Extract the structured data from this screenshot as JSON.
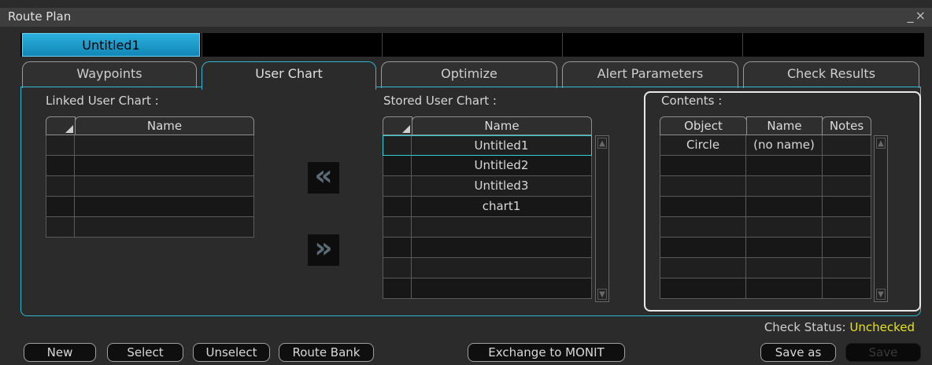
{
  "window": {
    "title": "Route Plan",
    "controls": "_×"
  },
  "route_fields": {
    "active": "Untitled1"
  },
  "tabs": [
    {
      "label": "Waypoints",
      "active": false
    },
    {
      "label": "User Chart",
      "active": true
    },
    {
      "label": "Optimize",
      "active": false
    },
    {
      "label": "Alert Parameters",
      "active": false
    },
    {
      "label": "Check Results",
      "active": false
    }
  ],
  "linked": {
    "label": "Linked User Chart :",
    "header": "Name",
    "rows": [
      "",
      "",
      "",
      "",
      ""
    ]
  },
  "transfer": {
    "add": "«",
    "remove": "»"
  },
  "stored": {
    "label": "Stored User Chart :",
    "header": "Name",
    "rows": [
      "Untitled1",
      "Untitled2",
      "Untitled3",
      "chart1",
      "",
      "",
      "",
      ""
    ],
    "selected_index": 0
  },
  "contents": {
    "label": "Contents :",
    "headers": [
      "Object",
      "Name",
      "Notes"
    ],
    "rows": [
      [
        "Circle",
        "(no name)",
        ""
      ],
      [
        "",
        "",
        ""
      ],
      [
        "",
        "",
        ""
      ],
      [
        "",
        "",
        ""
      ],
      [
        "",
        "",
        ""
      ],
      [
        "",
        "",
        ""
      ],
      [
        "",
        "",
        ""
      ],
      [
        "",
        "",
        ""
      ]
    ]
  },
  "check_status": {
    "label": "Check Status:",
    "value": "Unchecked"
  },
  "buttons": {
    "new": "New",
    "select": "Select",
    "unselect": "Unselect",
    "route_bank": "Route Bank",
    "exchange": "Exchange to MONIT",
    "save_as": "Save as",
    "save": "Save"
  },
  "colors": {
    "accent": "#2fb8d0",
    "status_warning": "#e6e21a",
    "active_field": "#1fa3d4"
  }
}
